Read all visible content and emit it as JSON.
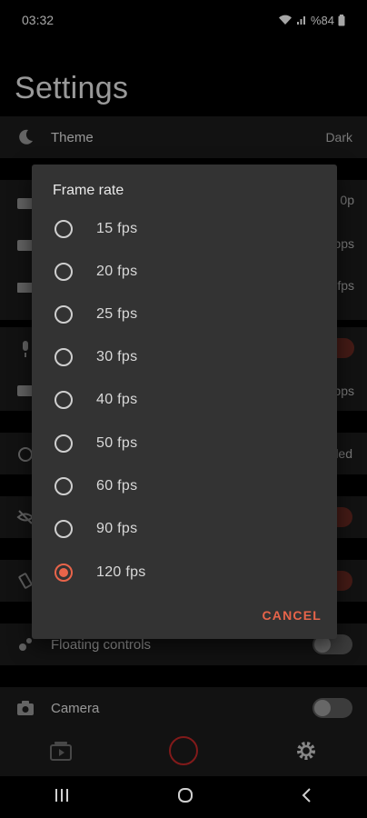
{
  "status_bar": {
    "time": "03:32",
    "battery": "%84"
  },
  "page_title": "Settings",
  "settings": {
    "theme": {
      "label": "Theme",
      "value": "Dark"
    },
    "res_value_fragment": "0p",
    "bitrate_value_fragment": "bps",
    "fps_value_fragment": "fps",
    "audio_bitrate_fragment": "bps",
    "timer_fragment": "led",
    "floating_controls": {
      "label": "Floating controls"
    },
    "camera": {
      "label": "Camera"
    }
  },
  "dialog": {
    "title": "Frame rate",
    "options": [
      {
        "label": "15 fps",
        "selected": false
      },
      {
        "label": "20 fps",
        "selected": false
      },
      {
        "label": "25 fps",
        "selected": false
      },
      {
        "label": "30 fps",
        "selected": false
      },
      {
        "label": "40 fps",
        "selected": false
      },
      {
        "label": "50 fps",
        "selected": false
      },
      {
        "label": "60 fps",
        "selected": false
      },
      {
        "label": "90 fps",
        "selected": false
      },
      {
        "label": "120 fps",
        "selected": true
      }
    ],
    "cancel_label": "CANCEL"
  },
  "colors": {
    "accent": "#e8644a",
    "record": "#c62828"
  },
  "icons": {
    "theme": "moon-icon",
    "floating": "bubbles-icon",
    "camera": "camera-icon",
    "gallery": "video-library-icon",
    "settings": "gear-icon"
  }
}
